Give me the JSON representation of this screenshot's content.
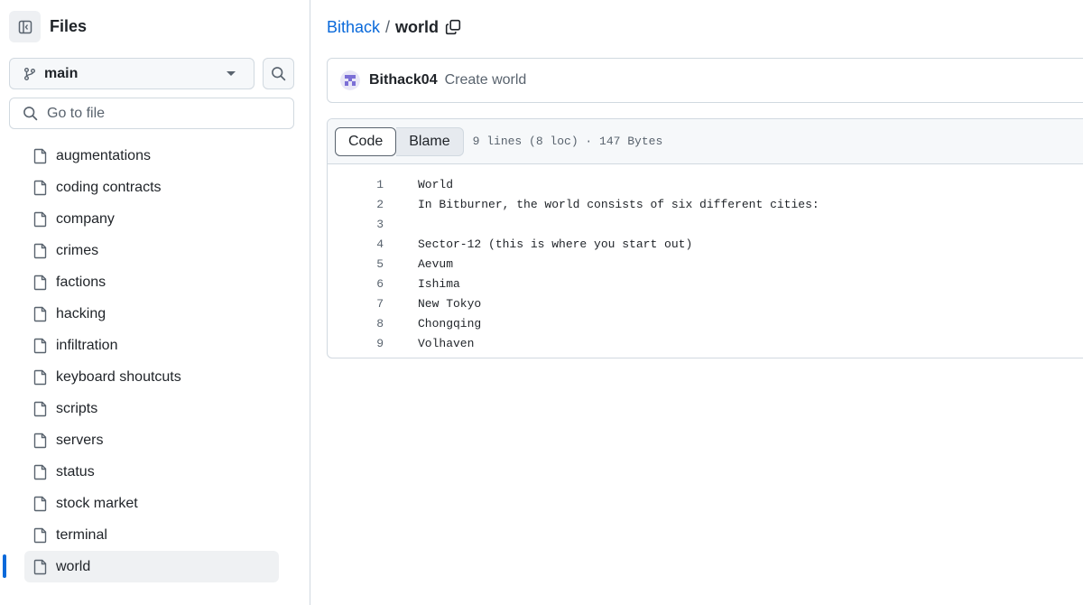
{
  "sidebar": {
    "title": "Files",
    "branch": "main",
    "goto_placeholder": "Go to file",
    "items": [
      {
        "label": "augmentations"
      },
      {
        "label": "coding contracts"
      },
      {
        "label": "company"
      },
      {
        "label": "crimes"
      },
      {
        "label": "factions"
      },
      {
        "label": "hacking"
      },
      {
        "label": "infiltration"
      },
      {
        "label": "keyboard shoutcuts"
      },
      {
        "label": "scripts"
      },
      {
        "label": "servers"
      },
      {
        "label": "status"
      },
      {
        "label": "stock market"
      },
      {
        "label": "terminal"
      },
      {
        "label": "world",
        "selected": true
      }
    ]
  },
  "breadcrumb": {
    "repo": "Bithack",
    "separator": "/",
    "file": "world"
  },
  "commit": {
    "author": "Bithack04",
    "message": "Create world"
  },
  "file": {
    "tabs": {
      "code": "Code",
      "blame": "Blame"
    },
    "meta": "9 lines (8 loc) · 147 Bytes",
    "lines": [
      {
        "n": "1",
        "text": "World"
      },
      {
        "n": "2",
        "text": "In Bitburner, the world consists of six different cities:"
      },
      {
        "n": "3",
        "text": ""
      },
      {
        "n": "4",
        "text": "Sector-12 (this is where you start out)"
      },
      {
        "n": "5",
        "text": "Aevum"
      },
      {
        "n": "6",
        "text": "Ishima"
      },
      {
        "n": "7",
        "text": "New Tokyo"
      },
      {
        "n": "8",
        "text": "Chongqing"
      },
      {
        "n": "9",
        "text": "Volhaven"
      }
    ]
  },
  "colors": {
    "accent": "#0969da",
    "text": "#1f2328",
    "muted": "#59636e",
    "border": "#d1d9e0"
  }
}
